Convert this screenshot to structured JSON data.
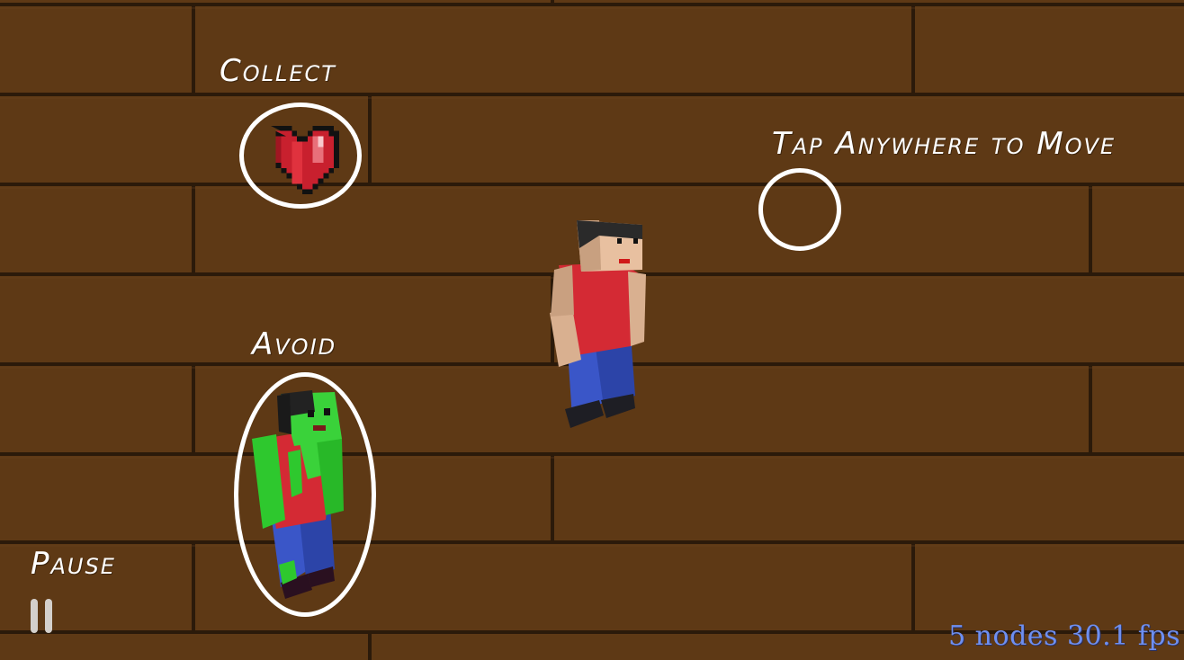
{
  "scene": {
    "colors": {
      "floor": "#5e3915",
      "floor_seam": "#2b1a0a",
      "ring": "#ffffff",
      "stats_text": "#6e8ff0"
    }
  },
  "tutorial": {
    "collect_label": "Collect",
    "avoid_label": "Avoid",
    "tap_label": "Tap Anywhere to Move",
    "pause_label": "Pause"
  },
  "hud": {
    "stats": "5 nodes 30.1 fps"
  },
  "icons": {
    "heart": "heart-icon",
    "pause": "pause-icon"
  }
}
